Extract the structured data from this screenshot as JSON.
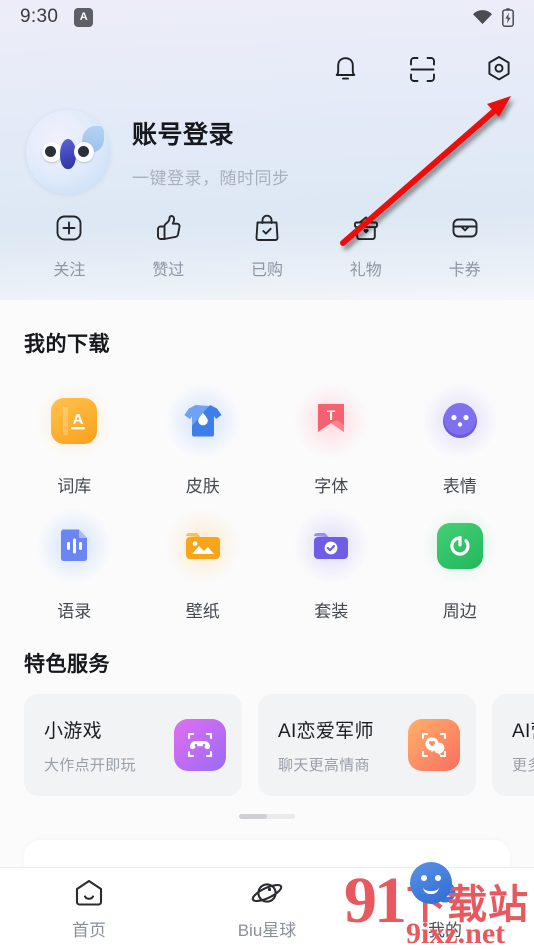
{
  "status_bar": {
    "time": "9:30",
    "badge_letter": "A",
    "icons": [
      "wifi-icon",
      "battery-charging-icon"
    ]
  },
  "header": {
    "icons": [
      {
        "name": "bell-icon",
        "label": "通知"
      },
      {
        "name": "scan-icon",
        "label": "扫一扫"
      },
      {
        "name": "settings-hexagon-icon",
        "label": "设置"
      }
    ]
  },
  "profile": {
    "title": "账号登录",
    "subtitle": "一键登录，随时同步",
    "avatar_name": "bird-avatar"
  },
  "quick_actions": [
    {
      "label": "关注",
      "icon": "plus-square-icon"
    },
    {
      "label": "赞过",
      "icon": "thumbs-up-icon"
    },
    {
      "label": "已购",
      "icon": "bag-check-icon"
    },
    {
      "label": "礼物",
      "icon": "gift-box-icon"
    },
    {
      "label": "卡券",
      "icon": "card-wallet-icon"
    }
  ],
  "downloads": {
    "title": "我的下载",
    "items": [
      {
        "label": "词库",
        "icon": "dictionary-icon",
        "color": "#f9a11b"
      },
      {
        "label": "皮肤",
        "icon": "tshirt-icon",
        "color": "#3f7de8"
      },
      {
        "label": "字体",
        "icon": "font-bookmark-icon",
        "color": "#f3616f"
      },
      {
        "label": "表情",
        "icon": "emoji-face-icon",
        "color": "#6a5ae0"
      },
      {
        "label": "语录",
        "icon": "quote-document-icon",
        "color": "#5f7ef0"
      },
      {
        "label": "壁纸",
        "icon": "wallpaper-folder-icon",
        "color": "#f9a11b"
      },
      {
        "label": "套装",
        "icon": "suite-folder-check-icon",
        "color": "#6a5ae0"
      },
      {
        "label": "周边",
        "icon": "peripheral-power-icon",
        "color": "#22b85c"
      }
    ]
  },
  "featured": {
    "title": "特色服务",
    "cards": [
      {
        "title": "小游戏",
        "subtitle": "大作点开即玩",
        "icon": "gamepad-icon"
      },
      {
        "title": "AI恋爱军师",
        "subtitle": "聊天更高情商",
        "icon": "chat-heart-icon"
      },
      {
        "title": "AI营销",
        "subtitle": "更多营",
        "icon": "marketing-icon"
      }
    ],
    "scroll_position": "left"
  },
  "bottom_nav": [
    {
      "label": "首页",
      "icon": "home-icon",
      "active": false
    },
    {
      "label": "Biu星球",
      "icon": "planet-icon",
      "active": false
    },
    {
      "label": "我的",
      "icon": "profile-face-icon",
      "active": true
    }
  ],
  "annotation": {
    "type": "arrow",
    "color": "#ee1111",
    "points_to": "settings-hexagon-icon"
  },
  "watermark": {
    "number": "91",
    "chinese": "下载站",
    "domain": "9ixz.net",
    "color": "#e8595f"
  }
}
